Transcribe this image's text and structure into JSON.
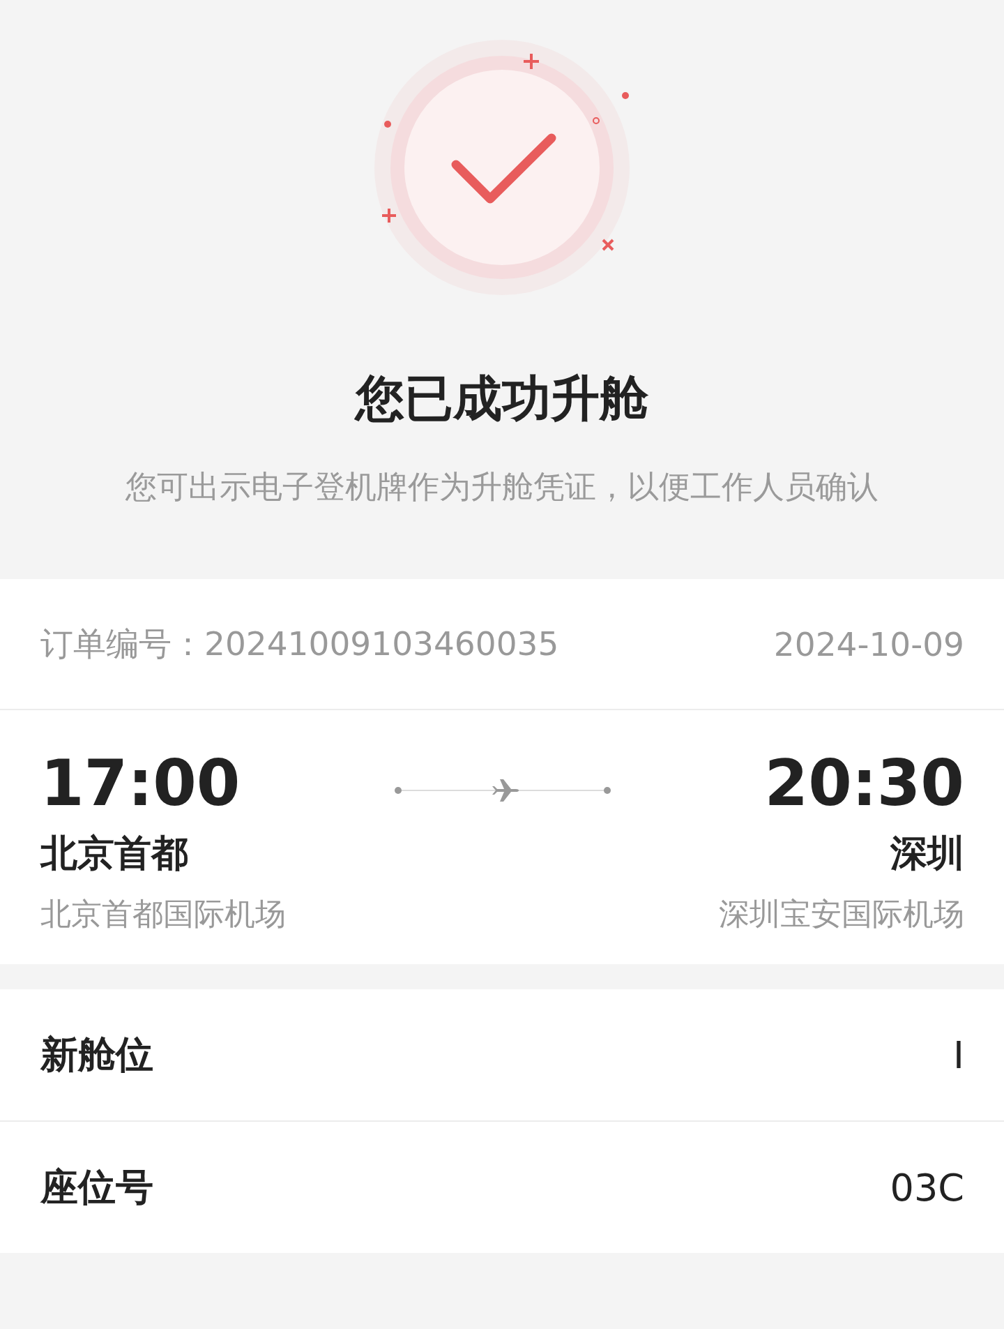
{
  "result": {
    "title": "您已成功升舱",
    "message": "您可出示电子登机牌作为升舱凭证，以便工作人员确认"
  },
  "order": {
    "label": "订单编号：",
    "number": "20241009103460035",
    "date": "2024-10-09"
  },
  "flight": {
    "departure": {
      "time": "17:00",
      "city": "北京首都",
      "airport": "北京首都国际机场"
    },
    "arrival": {
      "time": "20:30",
      "city": "深圳",
      "airport": "深圳宝安国际机场"
    }
  },
  "details": [
    {
      "label": "新舱位",
      "value": "I"
    },
    {
      "label": "座位号",
      "value": "03C"
    }
  ]
}
